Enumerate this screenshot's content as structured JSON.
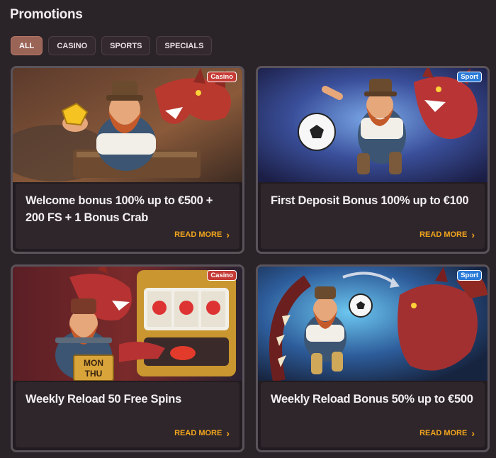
{
  "page": {
    "title": "Promotions"
  },
  "filters": [
    {
      "label": "ALL",
      "active": true
    },
    {
      "label": "CASINO",
      "active": false
    },
    {
      "label": "SPORTS",
      "active": false
    },
    {
      "label": "SPECIALS",
      "active": false
    }
  ],
  "promotions": [
    {
      "title": "Welcome bonus 100% up to €500 + 200 FS + 1 Bonus Crab",
      "badge": "Casino",
      "cta": "READ MORE",
      "art": "dwarf-holding-gold-nugget-with-dragon"
    },
    {
      "title": "First Deposit Bonus 100% up to €100",
      "badge": "Sport",
      "cta": "READ MORE",
      "art": "dwarf-kicking-football-with-dragon"
    },
    {
      "title": "Weekly Reload 50 Free Spins",
      "badge": "Casino",
      "cta": "READ MORE",
      "art": "dwarf-at-slot-machine-with-dragon",
      "art_text": {
        "line1": "MON",
        "line2": "THU"
      }
    },
    {
      "title": "Weekly Reload Bonus 50% up to €500",
      "badge": "Sport",
      "cta": "READ MORE",
      "art": "dwarf-and-dragon-heading-football"
    }
  ],
  "colors": {
    "background": "#2a2327",
    "active_tab": "#9a6457",
    "cta": "#f3a51d",
    "casino_badge": "#c53b35",
    "sport_badge": "#2a7bd7"
  }
}
